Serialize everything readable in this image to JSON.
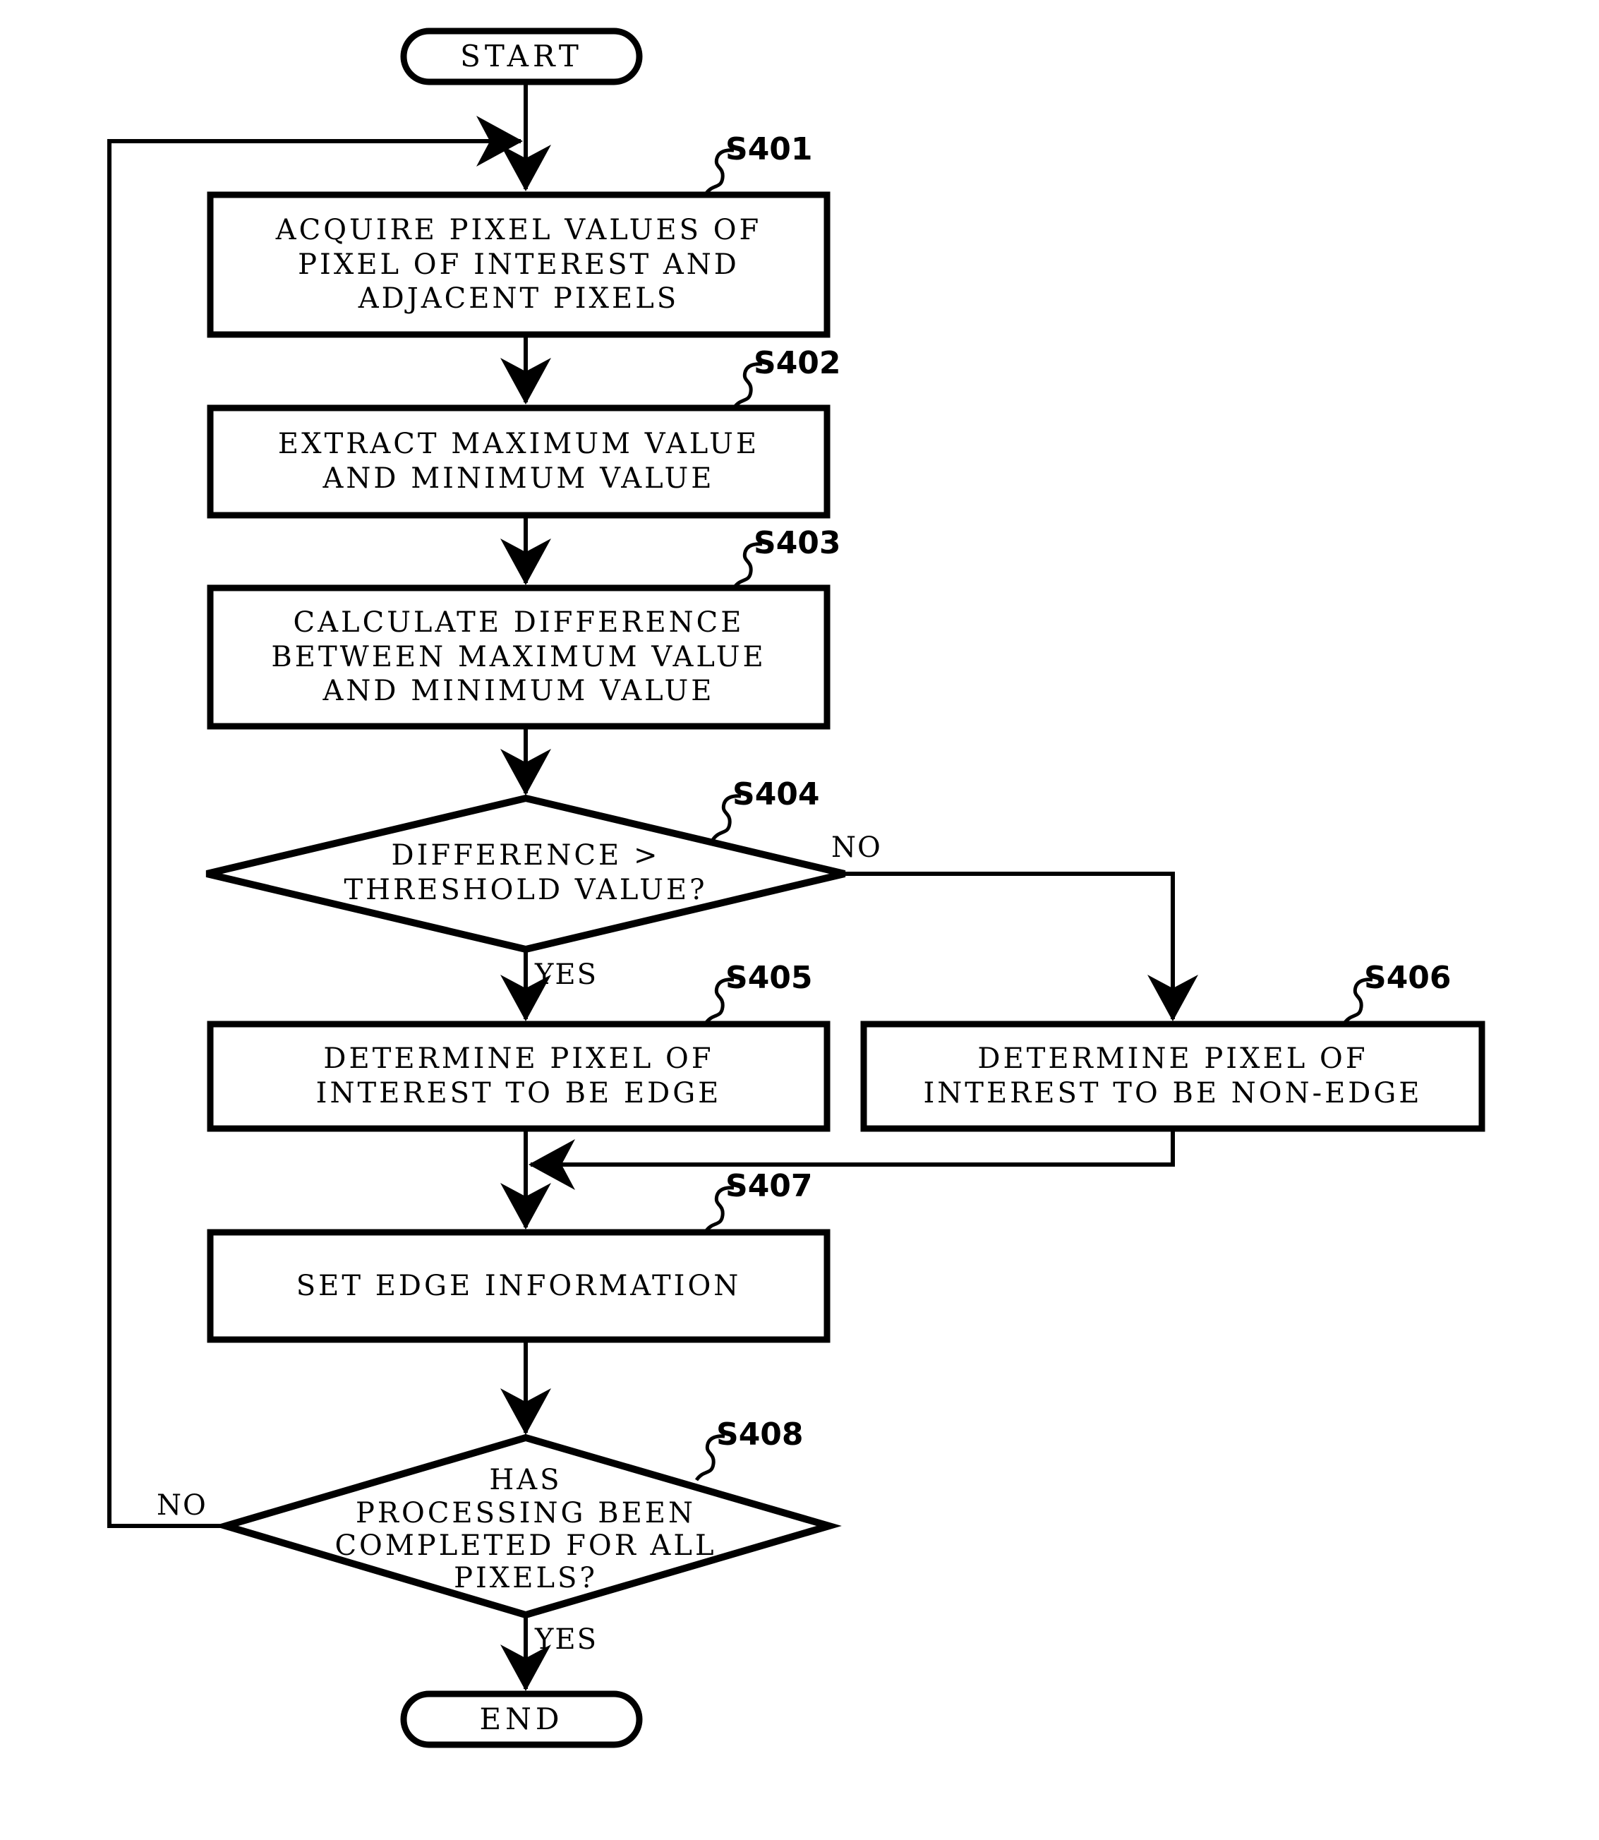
{
  "diagram": {
    "type": "flowchart",
    "title": "",
    "nodes": [
      {
        "id": "start",
        "shape": "terminator",
        "text": "START"
      },
      {
        "id": "s401",
        "shape": "process",
        "step": "S401",
        "text": "ACQUIRE PIXEL VALUES OF\nPIXEL OF INTEREST AND\nADJACENT PIXELS"
      },
      {
        "id": "s402",
        "shape": "process",
        "step": "S402",
        "text": "EXTRACT MAXIMUM VALUE\nAND MINIMUM VALUE"
      },
      {
        "id": "s403",
        "shape": "process",
        "step": "S403",
        "text": "CALCULATE DIFFERENCE\nBETWEEN MAXIMUM VALUE\nAND MINIMUM VALUE"
      },
      {
        "id": "s404",
        "shape": "decision",
        "step": "S404",
        "text": "DIFFERENCE >\nTHRESHOLD VALUE?"
      },
      {
        "id": "s405",
        "shape": "process",
        "step": "S405",
        "text": "DETERMINE PIXEL OF\nINTEREST TO BE EDGE"
      },
      {
        "id": "s406",
        "shape": "process",
        "step": "S406",
        "text": "DETERMINE PIXEL OF\nINTEREST TO BE NON-EDGE"
      },
      {
        "id": "s407",
        "shape": "process",
        "step": "S407",
        "text": "SET EDGE INFORMATION"
      },
      {
        "id": "s408",
        "shape": "decision",
        "step": "S408",
        "text": "HAS\nPROCESSING BEEN\nCOMPLETED FOR ALL\nPIXELS?"
      },
      {
        "id": "end",
        "shape": "terminator",
        "text": "END"
      }
    ],
    "branch_labels": {
      "s404_no": "NO",
      "s404_yes": "YES",
      "s408_no": "NO",
      "s408_yes": "YES"
    },
    "stroke_color": "#000000",
    "fill_color": "#ffffff"
  }
}
